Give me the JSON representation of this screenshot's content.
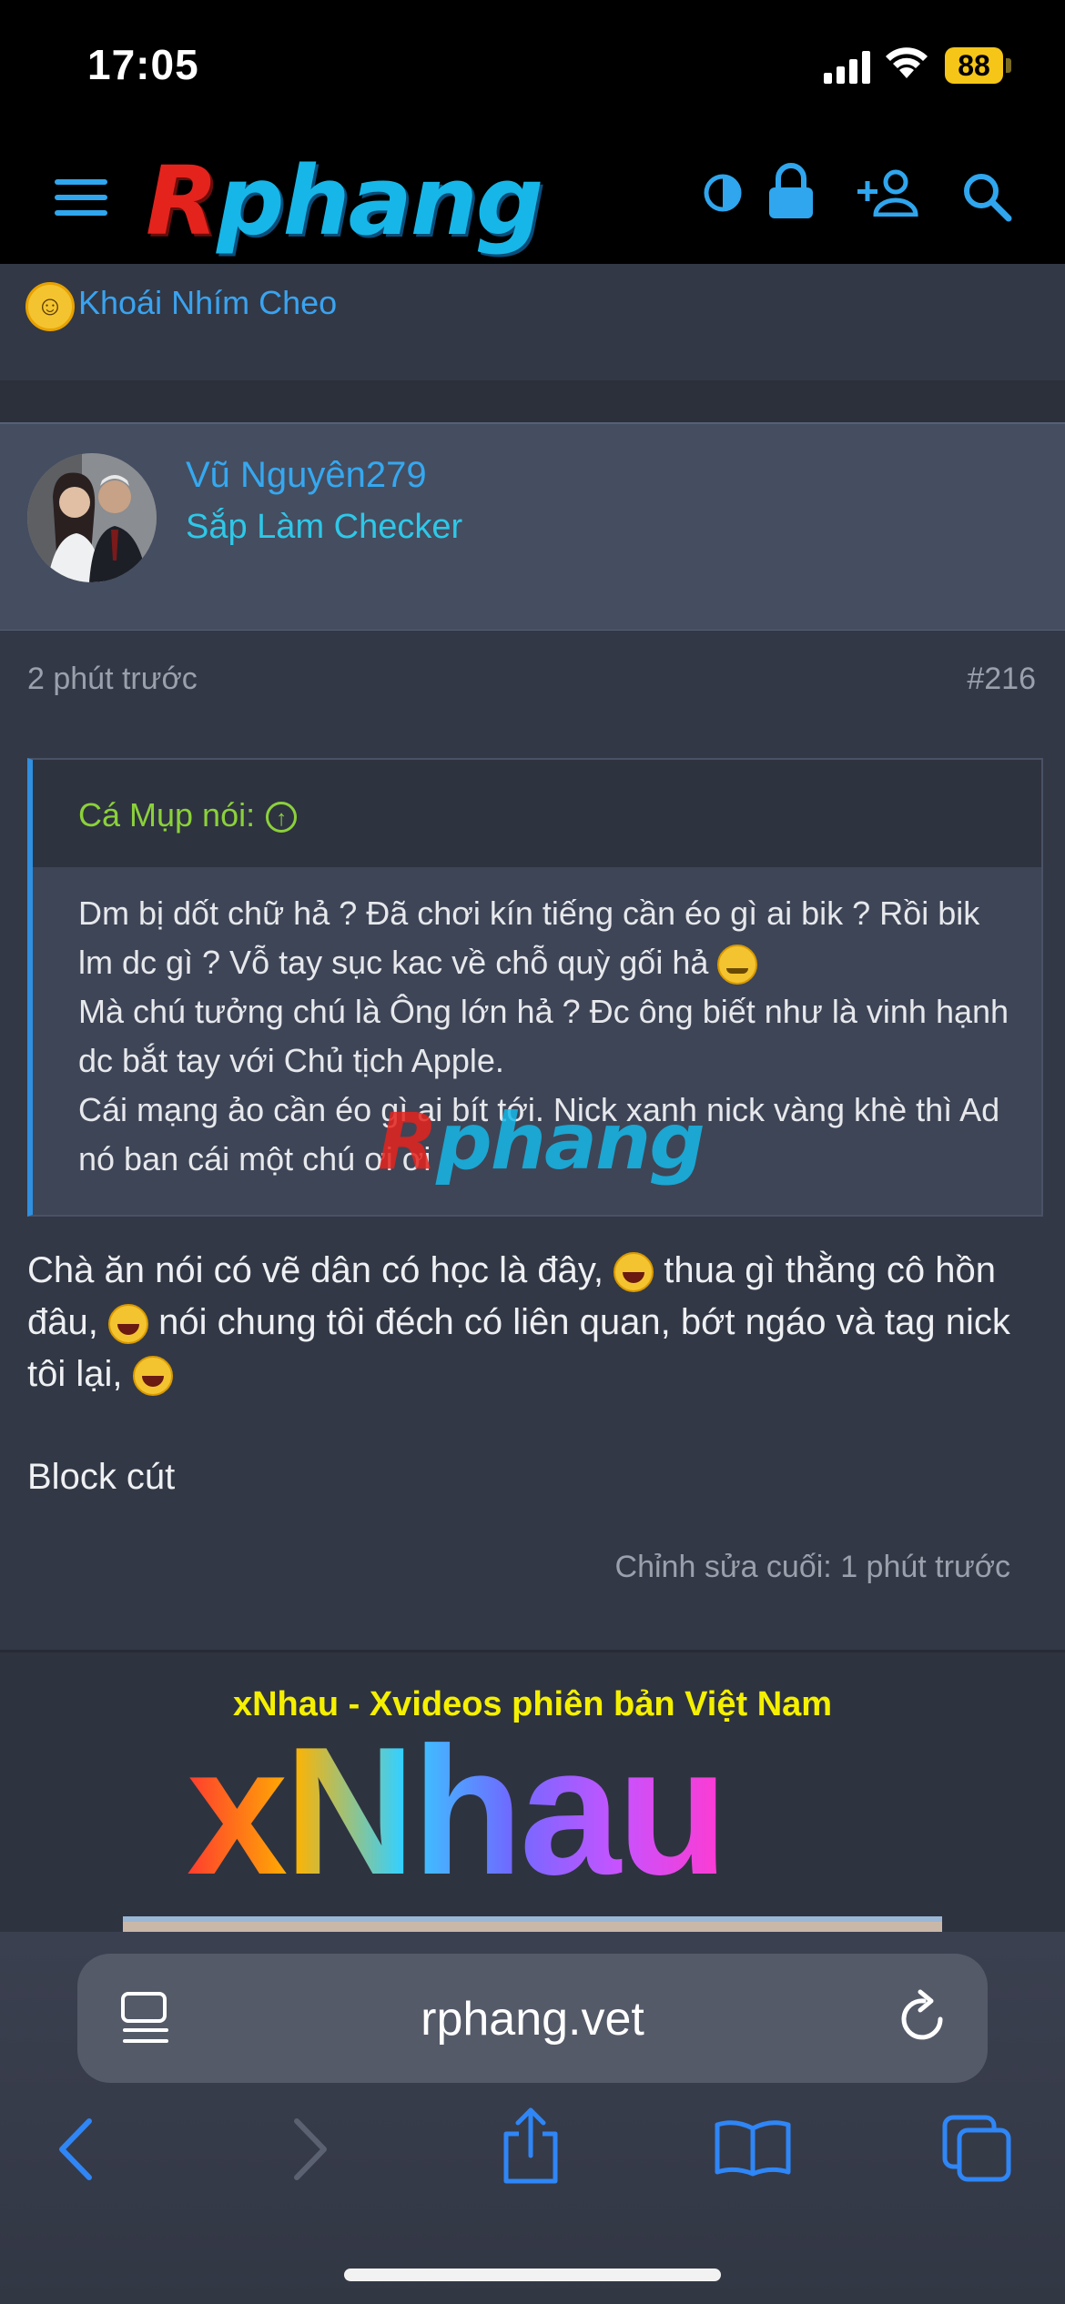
{
  "status_bar": {
    "time": "17:05",
    "battery": "88",
    "battery_color": "#f5c518"
  },
  "header": {
    "logo_text": "Rphang",
    "logo_colors": {
      "r": "#e4231d",
      "rest": "#16b7e8"
    },
    "icons": [
      "menu-icon",
      "contrast-icon",
      "lock-icon",
      "add-user-icon",
      "search-icon"
    ]
  },
  "previous_post": {
    "reaction_icon": "laughing-emoji",
    "reaction_text": "Khoái Nhím Cheo"
  },
  "post": {
    "author": {
      "name": "Vũ Nguyên279",
      "title": "Sắp Làm Checker"
    },
    "time": "2 phút trước",
    "number": "#216",
    "quote": {
      "author_label": "Cá Mụp nói:",
      "lines": [
        "Dm bị dốt chữ hả ? Đã chơi kín tiếng cần éo gì ai bik ? Rồi bik lm dc gì ? Vỗ tay sục kac về chỗ quỳ gối hả",
        "Mà chú tưởng chú là Ông lớn hả ? Đc ông biết như là vinh hạnh dc bắt tay với Chủ tịch Apple.",
        "Cái mạng ảo cần éo gì ai bít tới. Nick xanh nick vàng khè thì Ad nó ban cái một chú ơi ơi"
      ]
    },
    "body": {
      "part1": "Chà ăn nói có vẽ dân có học là đây,",
      "part2": "thua gì thằng cô hồn đâu,",
      "part3": "nói chung tôi đéch có liên quan, bớt ngáo và tag nick tôi lại,",
      "part4": "Block cút"
    },
    "edit_note": "Chỉnh sửa cuối: 1 phút trước",
    "watermark": "Rphang"
  },
  "ad": {
    "title": "xNhau - Xvideos phiên bản Việt Nam",
    "logo": "xNhau"
  },
  "browser": {
    "url": "rphang.vet",
    "toolbar": [
      "back-icon",
      "forward-icon",
      "share-icon",
      "bookmarks-icon",
      "tabs-icon"
    ]
  }
}
